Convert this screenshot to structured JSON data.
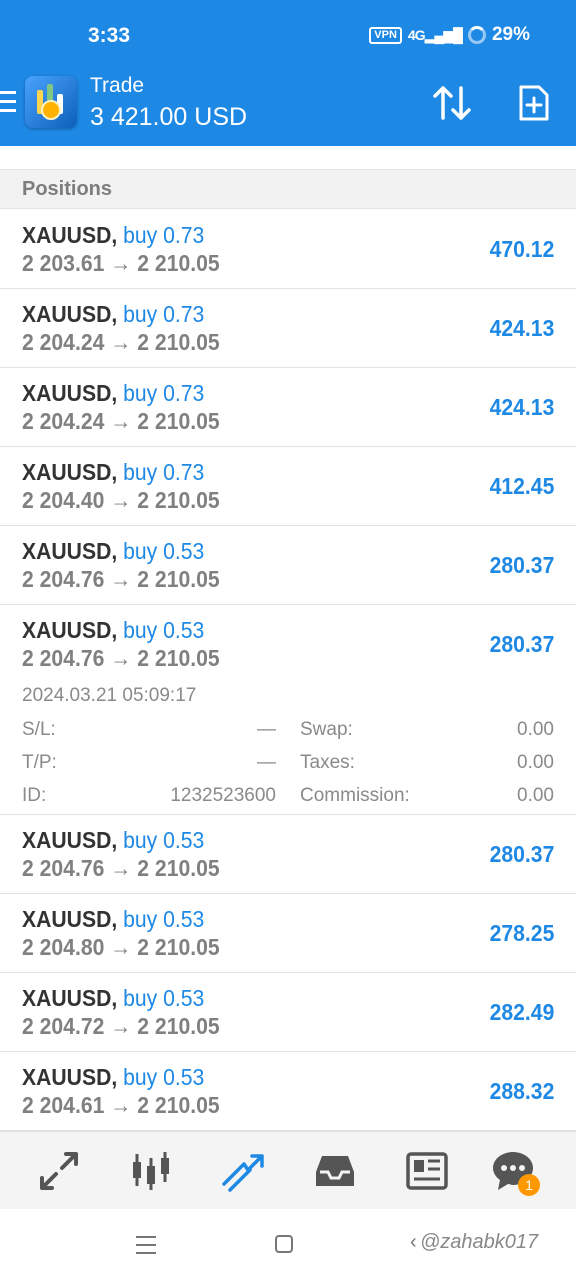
{
  "status_bar": {
    "time": "3:33",
    "vpn": "VPN",
    "network": "4G",
    "battery": "29%"
  },
  "header": {
    "title": "Trade",
    "balance": "3 421.00 USD"
  },
  "section": {
    "title": "Positions"
  },
  "positions": [
    {
      "symbol": "XAUUSD,",
      "side": "buy 0.73",
      "open_price": "2 203.61",
      "arrow": "→",
      "current_price": "2 210.05",
      "profit": "470.12"
    },
    {
      "symbol": "XAUUSD,",
      "side": "buy 0.73",
      "open_price": "2 204.24",
      "arrow": "→",
      "current_price": "2 210.05",
      "profit": "424.13"
    },
    {
      "symbol": "XAUUSD,",
      "side": "buy 0.73",
      "open_price": "2 204.24",
      "arrow": "→",
      "current_price": "2 210.05",
      "profit": "424.13"
    },
    {
      "symbol": "XAUUSD,",
      "side": "buy 0.73",
      "open_price": "2 204.40",
      "arrow": "→",
      "current_price": "2 210.05",
      "profit": "412.45"
    },
    {
      "symbol": "XAUUSD,",
      "side": "buy 0.53",
      "open_price": "2 204.76",
      "arrow": "→",
      "current_price": "2 210.05",
      "profit": "280.37"
    },
    {
      "symbol": "XAUUSD,",
      "side": "buy 0.53",
      "open_price": "2 204.76",
      "arrow": "→",
      "current_price": "2 210.05",
      "profit": "280.37",
      "details": {
        "time": "2024.03.21 05:09:17",
        "sl_label": "S/L:",
        "sl_value": "—",
        "tp_label": "T/P:",
        "tp_value": "—",
        "id_label": "ID:",
        "id_value": "1232523600",
        "swap_label": "Swap:",
        "swap_value": "0.00",
        "taxes_label": "Taxes:",
        "taxes_value": "0.00",
        "commission_label": "Commission:",
        "commission_value": "0.00"
      }
    },
    {
      "symbol": "XAUUSD,",
      "side": "buy 0.53",
      "open_price": "2 204.76",
      "arrow": "→",
      "current_price": "2 210.05",
      "profit": "280.37"
    },
    {
      "symbol": "XAUUSD,",
      "side": "buy 0.53",
      "open_price": "2 204.80",
      "arrow": "→",
      "current_price": "2 210.05",
      "profit": "278.25"
    },
    {
      "symbol": "XAUUSD,",
      "side": "buy 0.53",
      "open_price": "2 204.72",
      "arrow": "→",
      "current_price": "2 210.05",
      "profit": "282.49"
    },
    {
      "symbol": "XAUUSD,",
      "side": "buy 0.53",
      "open_price": "2 204.61",
      "arrow": "→",
      "current_price": "2 210.05",
      "profit": "288.32"
    }
  ],
  "bottom_nav": {
    "items": [
      "quotes-icon",
      "chart-icon",
      "trade-icon",
      "history-icon",
      "news-icon",
      "chat-icon"
    ],
    "chat_badge": "1"
  },
  "watermark": "@zahabk017",
  "colors": {
    "primary": "#1e88e5",
    "badge": "#ff9800"
  }
}
